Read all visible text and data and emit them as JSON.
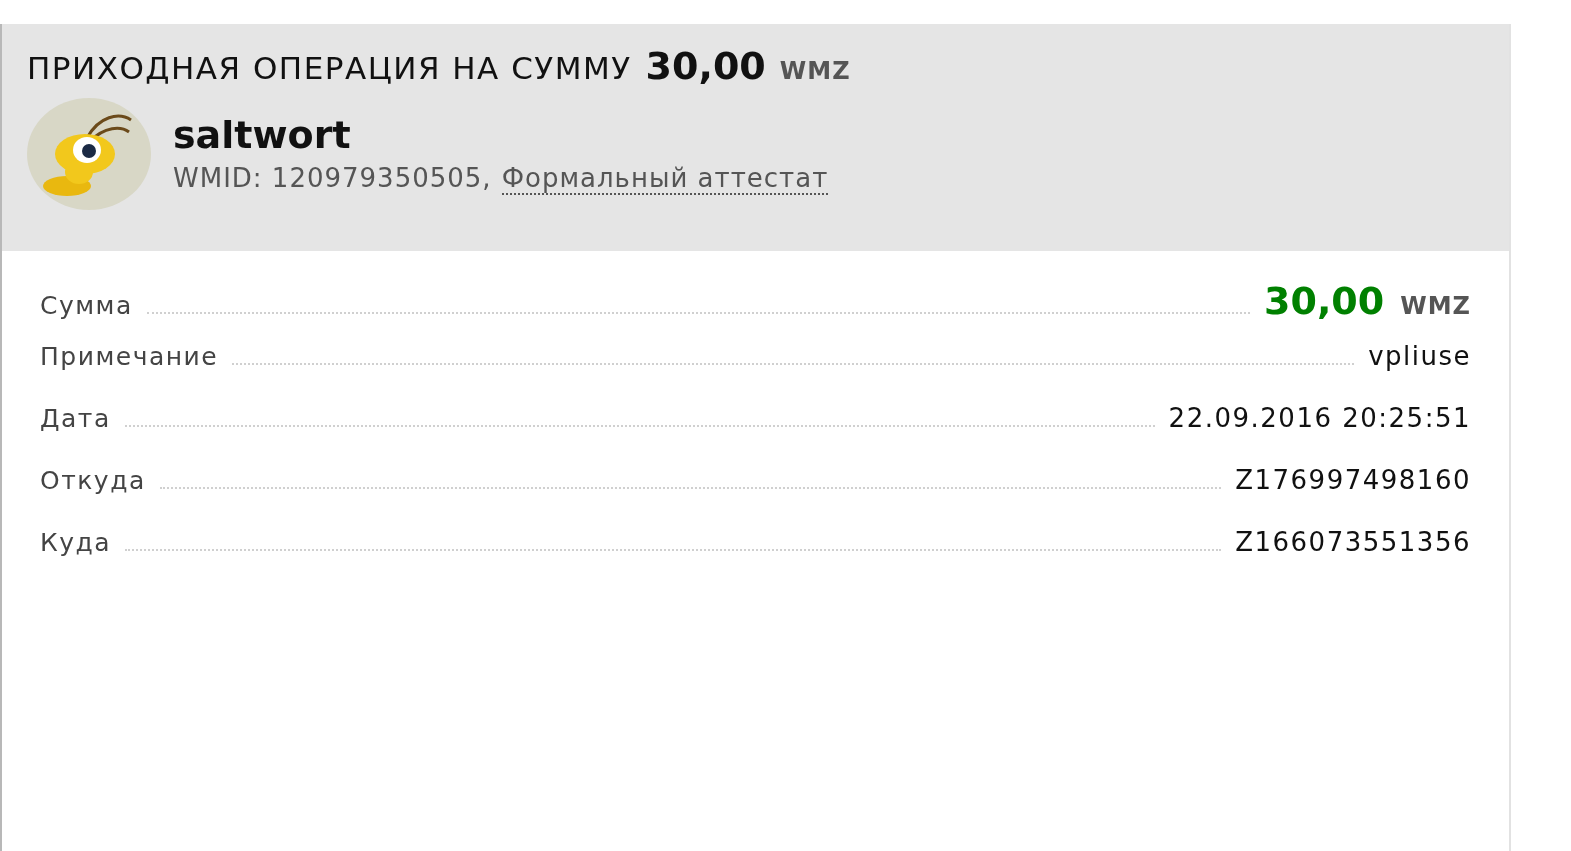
{
  "header": {
    "title": "ПРИХОДНАЯ ОПЕРАЦИЯ НА СУММУ",
    "amount": "30,00",
    "currency": "WMZ",
    "user": {
      "name": "saltwort",
      "wmid": "WMID: 120979350505,",
      "attestat": "Формальный аттестат"
    }
  },
  "details": [
    {
      "kind": "amount",
      "label": "Сумма",
      "value": "30,00",
      "currency": "WMZ"
    },
    {
      "kind": "text",
      "label": "Примечание",
      "value": "vpliuse"
    },
    {
      "kind": "text",
      "label": "Дата",
      "value": "22.09.2016 20:25:51"
    },
    {
      "kind": "text",
      "label": "Откуда",
      "value": "Z176997498160"
    },
    {
      "kind": "text",
      "label": "Куда",
      "value": "Z166073551356"
    }
  ]
}
